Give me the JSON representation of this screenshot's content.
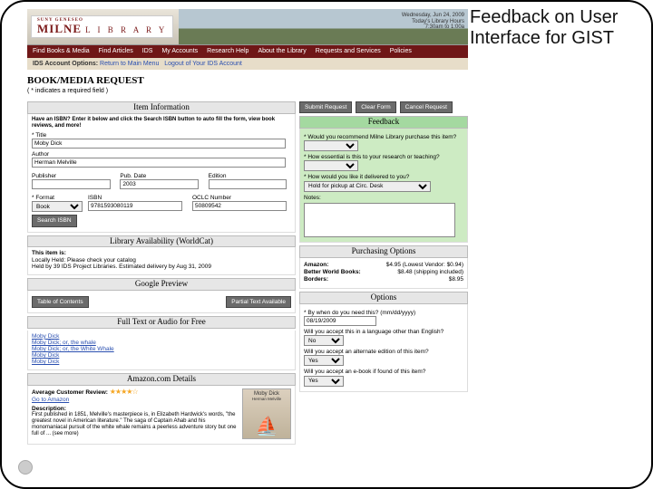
{
  "annotation": "Feedback on User Interface for GIST",
  "banner": {
    "tagline_top": "SUNY GENESEO",
    "logo_main": "MILNE",
    "logo_sub": "L I B R A R Y",
    "date_line": "Wednesday, Jun 24, 2009",
    "hours_line1": "Today's Library Hours",
    "hours_line2": "7:30am to 1:00a"
  },
  "nav": [
    "Find Books & Media",
    "Find Articles",
    "IDS",
    "My Accounts",
    "Research Help",
    "About the Library",
    "Requests and Services",
    "Policies"
  ],
  "subnav": {
    "label": "IDS Account Options: ",
    "links": [
      "Return to Main Menu",
      "Logout of Your IDS Account"
    ]
  },
  "page_title": "BOOK/MEDIA REQUEST",
  "required_note": "( * indicates a required field )",
  "item_info": {
    "head": "Item Information",
    "blurb": "Have an ISBN? Enter it below and click the Search ISBN button to auto fill the form, view book reviews, and more!",
    "title_label": "* Title",
    "title_val": "Moby Dick",
    "author_label": "Author",
    "author_val": "Herman Melville",
    "publisher_label": "Publisher",
    "pubdate_label": "Pub. Date",
    "pubdate_val": "2003",
    "edition_label": "Edition",
    "format_label": "* Format",
    "format_val": "Book",
    "isbn_label": "ISBN",
    "isbn_val": "9781593080119",
    "oclc_label": "OCLC Number",
    "oclc_val": "50809542",
    "search_btn": "Search ISBN"
  },
  "availability": {
    "head": "Library Availability (WorldCat)",
    "line1_label": "This item is:",
    "line1_val": "Locally Held: Please check your catalog",
    "line2": "Held by 39 IDS Project Libraries. Estimated delivery by Aug 31, 2009"
  },
  "preview": {
    "head": "Google Preview",
    "btn1": "Table of Contents",
    "btn2": "Partial Text Available"
  },
  "fulltext": {
    "head": "Full Text or Audio for Free",
    "links": [
      "Moby Dick",
      "Moby Dick; or, the whale",
      "Moby Dick; or, the White Whale",
      "Moby Dick",
      "Moby Dick"
    ]
  },
  "amazon": {
    "head": "Amazon.com Details",
    "avg_label": "Average Customer Review:",
    "go_link": "Go to Amazon",
    "desc_label": "Description:",
    "desc_text": "First published in 1851, Melville's masterpiece is, in Elizabeth Hardwick's words, \"the greatest novel in American literature.\" The saga of Captain Ahab and his monomaniacal pursuit of the white whale remains a peerless adventure story but one full of ... (see more)",
    "cover_title": "Moby Dick",
    "cover_author": "Herman Melville"
  },
  "top_buttons": [
    "Submit Request",
    "Clear Form",
    "Cancel Request"
  ],
  "feedback": {
    "head": "Feedback",
    "q1": "* Would you recommend Milne Library purchase this item?",
    "q2": "* How essential is this to your research or teaching?",
    "q3": "* How would you like it delivered to you?",
    "q3_val": "Hold for pickup at Circ. Desk",
    "notes_label": "Notes:"
  },
  "purchasing": {
    "head": "Purchasing Options",
    "rows": [
      {
        "vendor": "Amazon:",
        "price": "$4.95 (Lowest Vendor: $0.94)"
      },
      {
        "vendor": "Better World Books:",
        "price": "$8.48 (shipping included)"
      },
      {
        "vendor": "Borders:",
        "price": "$8.95"
      }
    ]
  },
  "options": {
    "head": "Options",
    "q1": "* By when do you need this? (mm/dd/yyyy)",
    "q1_val": "08/19/2009",
    "q2": "Will you accept this in a language other than English?",
    "q2_val": "No",
    "q3": "Will you accept an alternate edition of this item?",
    "q3_val": "Yes",
    "q4": "Will you accept an e-book if found of this item?",
    "q4_val": "Yes"
  }
}
